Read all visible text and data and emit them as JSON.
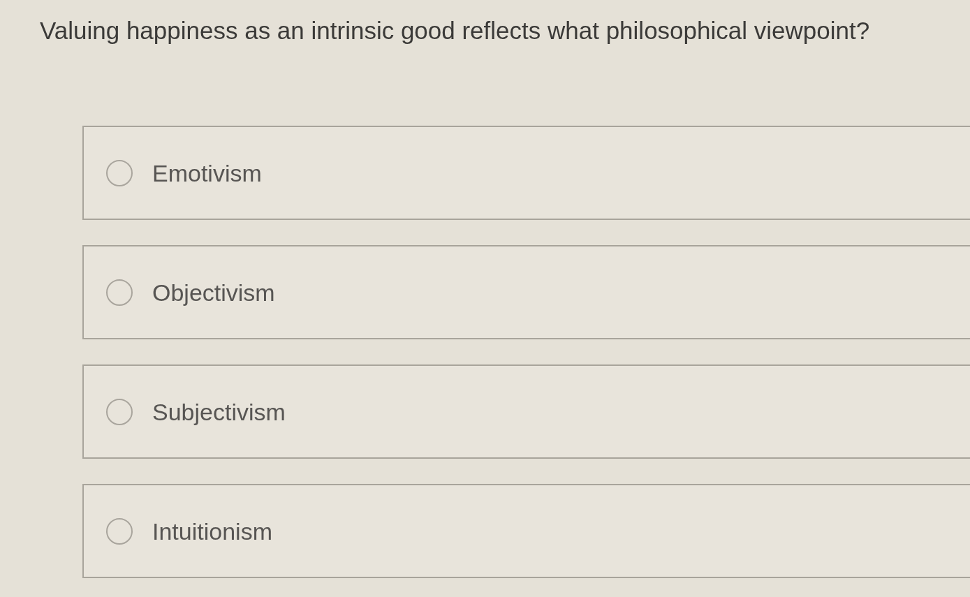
{
  "question": "Valuing happiness as an intrinsic good reflects what philosophical viewpoint?",
  "options": [
    {
      "label": "Emotivism",
      "selected": false
    },
    {
      "label": "Objectivism",
      "selected": false
    },
    {
      "label": "Subjectivism",
      "selected": false
    },
    {
      "label": "Intuitionism",
      "selected": false
    }
  ]
}
